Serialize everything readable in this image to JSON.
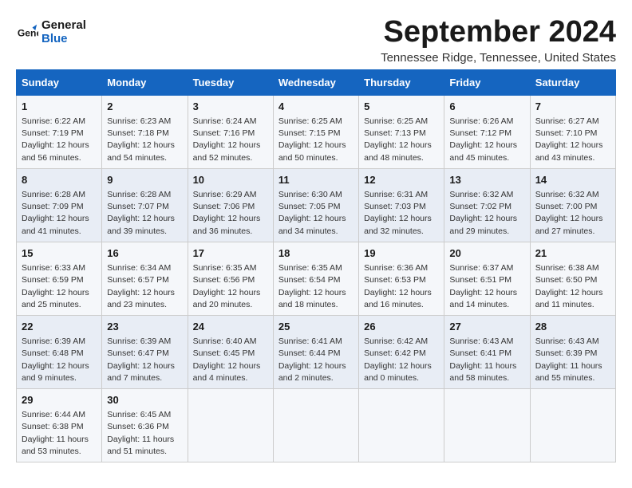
{
  "logo": {
    "line1": "General",
    "line2": "Blue"
  },
  "title": "September 2024",
  "location": "Tennessee Ridge, Tennessee, United States",
  "weekdays": [
    "Sunday",
    "Monday",
    "Tuesday",
    "Wednesday",
    "Thursday",
    "Friday",
    "Saturday"
  ],
  "weeks": [
    [
      {
        "day": "1",
        "info": "Sunrise: 6:22 AM\nSunset: 7:19 PM\nDaylight: 12 hours\nand 56 minutes."
      },
      {
        "day": "2",
        "info": "Sunrise: 6:23 AM\nSunset: 7:18 PM\nDaylight: 12 hours\nand 54 minutes."
      },
      {
        "day": "3",
        "info": "Sunrise: 6:24 AM\nSunset: 7:16 PM\nDaylight: 12 hours\nand 52 minutes."
      },
      {
        "day": "4",
        "info": "Sunrise: 6:25 AM\nSunset: 7:15 PM\nDaylight: 12 hours\nand 50 minutes."
      },
      {
        "day": "5",
        "info": "Sunrise: 6:25 AM\nSunset: 7:13 PM\nDaylight: 12 hours\nand 48 minutes."
      },
      {
        "day": "6",
        "info": "Sunrise: 6:26 AM\nSunset: 7:12 PM\nDaylight: 12 hours\nand 45 minutes."
      },
      {
        "day": "7",
        "info": "Sunrise: 6:27 AM\nSunset: 7:10 PM\nDaylight: 12 hours\nand 43 minutes."
      }
    ],
    [
      {
        "day": "8",
        "info": "Sunrise: 6:28 AM\nSunset: 7:09 PM\nDaylight: 12 hours\nand 41 minutes."
      },
      {
        "day": "9",
        "info": "Sunrise: 6:28 AM\nSunset: 7:07 PM\nDaylight: 12 hours\nand 39 minutes."
      },
      {
        "day": "10",
        "info": "Sunrise: 6:29 AM\nSunset: 7:06 PM\nDaylight: 12 hours\nand 36 minutes."
      },
      {
        "day": "11",
        "info": "Sunrise: 6:30 AM\nSunset: 7:05 PM\nDaylight: 12 hours\nand 34 minutes."
      },
      {
        "day": "12",
        "info": "Sunrise: 6:31 AM\nSunset: 7:03 PM\nDaylight: 12 hours\nand 32 minutes."
      },
      {
        "day": "13",
        "info": "Sunrise: 6:32 AM\nSunset: 7:02 PM\nDaylight: 12 hours\nand 29 minutes."
      },
      {
        "day": "14",
        "info": "Sunrise: 6:32 AM\nSunset: 7:00 PM\nDaylight: 12 hours\nand 27 minutes."
      }
    ],
    [
      {
        "day": "15",
        "info": "Sunrise: 6:33 AM\nSunset: 6:59 PM\nDaylight: 12 hours\nand 25 minutes."
      },
      {
        "day": "16",
        "info": "Sunrise: 6:34 AM\nSunset: 6:57 PM\nDaylight: 12 hours\nand 23 minutes."
      },
      {
        "day": "17",
        "info": "Sunrise: 6:35 AM\nSunset: 6:56 PM\nDaylight: 12 hours\nand 20 minutes."
      },
      {
        "day": "18",
        "info": "Sunrise: 6:35 AM\nSunset: 6:54 PM\nDaylight: 12 hours\nand 18 minutes."
      },
      {
        "day": "19",
        "info": "Sunrise: 6:36 AM\nSunset: 6:53 PM\nDaylight: 12 hours\nand 16 minutes."
      },
      {
        "day": "20",
        "info": "Sunrise: 6:37 AM\nSunset: 6:51 PM\nDaylight: 12 hours\nand 14 minutes."
      },
      {
        "day": "21",
        "info": "Sunrise: 6:38 AM\nSunset: 6:50 PM\nDaylight: 12 hours\nand 11 minutes."
      }
    ],
    [
      {
        "day": "22",
        "info": "Sunrise: 6:39 AM\nSunset: 6:48 PM\nDaylight: 12 hours\nand 9 minutes."
      },
      {
        "day": "23",
        "info": "Sunrise: 6:39 AM\nSunset: 6:47 PM\nDaylight: 12 hours\nand 7 minutes."
      },
      {
        "day": "24",
        "info": "Sunrise: 6:40 AM\nSunset: 6:45 PM\nDaylight: 12 hours\nand 4 minutes."
      },
      {
        "day": "25",
        "info": "Sunrise: 6:41 AM\nSunset: 6:44 PM\nDaylight: 12 hours\nand 2 minutes."
      },
      {
        "day": "26",
        "info": "Sunrise: 6:42 AM\nSunset: 6:42 PM\nDaylight: 12 hours\nand 0 minutes."
      },
      {
        "day": "27",
        "info": "Sunrise: 6:43 AM\nSunset: 6:41 PM\nDaylight: 11 hours\nand 58 minutes."
      },
      {
        "day": "28",
        "info": "Sunrise: 6:43 AM\nSunset: 6:39 PM\nDaylight: 11 hours\nand 55 minutes."
      }
    ],
    [
      {
        "day": "29",
        "info": "Sunrise: 6:44 AM\nSunset: 6:38 PM\nDaylight: 11 hours\nand 53 minutes."
      },
      {
        "day": "30",
        "info": "Sunrise: 6:45 AM\nSunset: 6:36 PM\nDaylight: 11 hours\nand 51 minutes."
      },
      {
        "day": "",
        "info": ""
      },
      {
        "day": "",
        "info": ""
      },
      {
        "day": "",
        "info": ""
      },
      {
        "day": "",
        "info": ""
      },
      {
        "day": "",
        "info": ""
      }
    ]
  ]
}
